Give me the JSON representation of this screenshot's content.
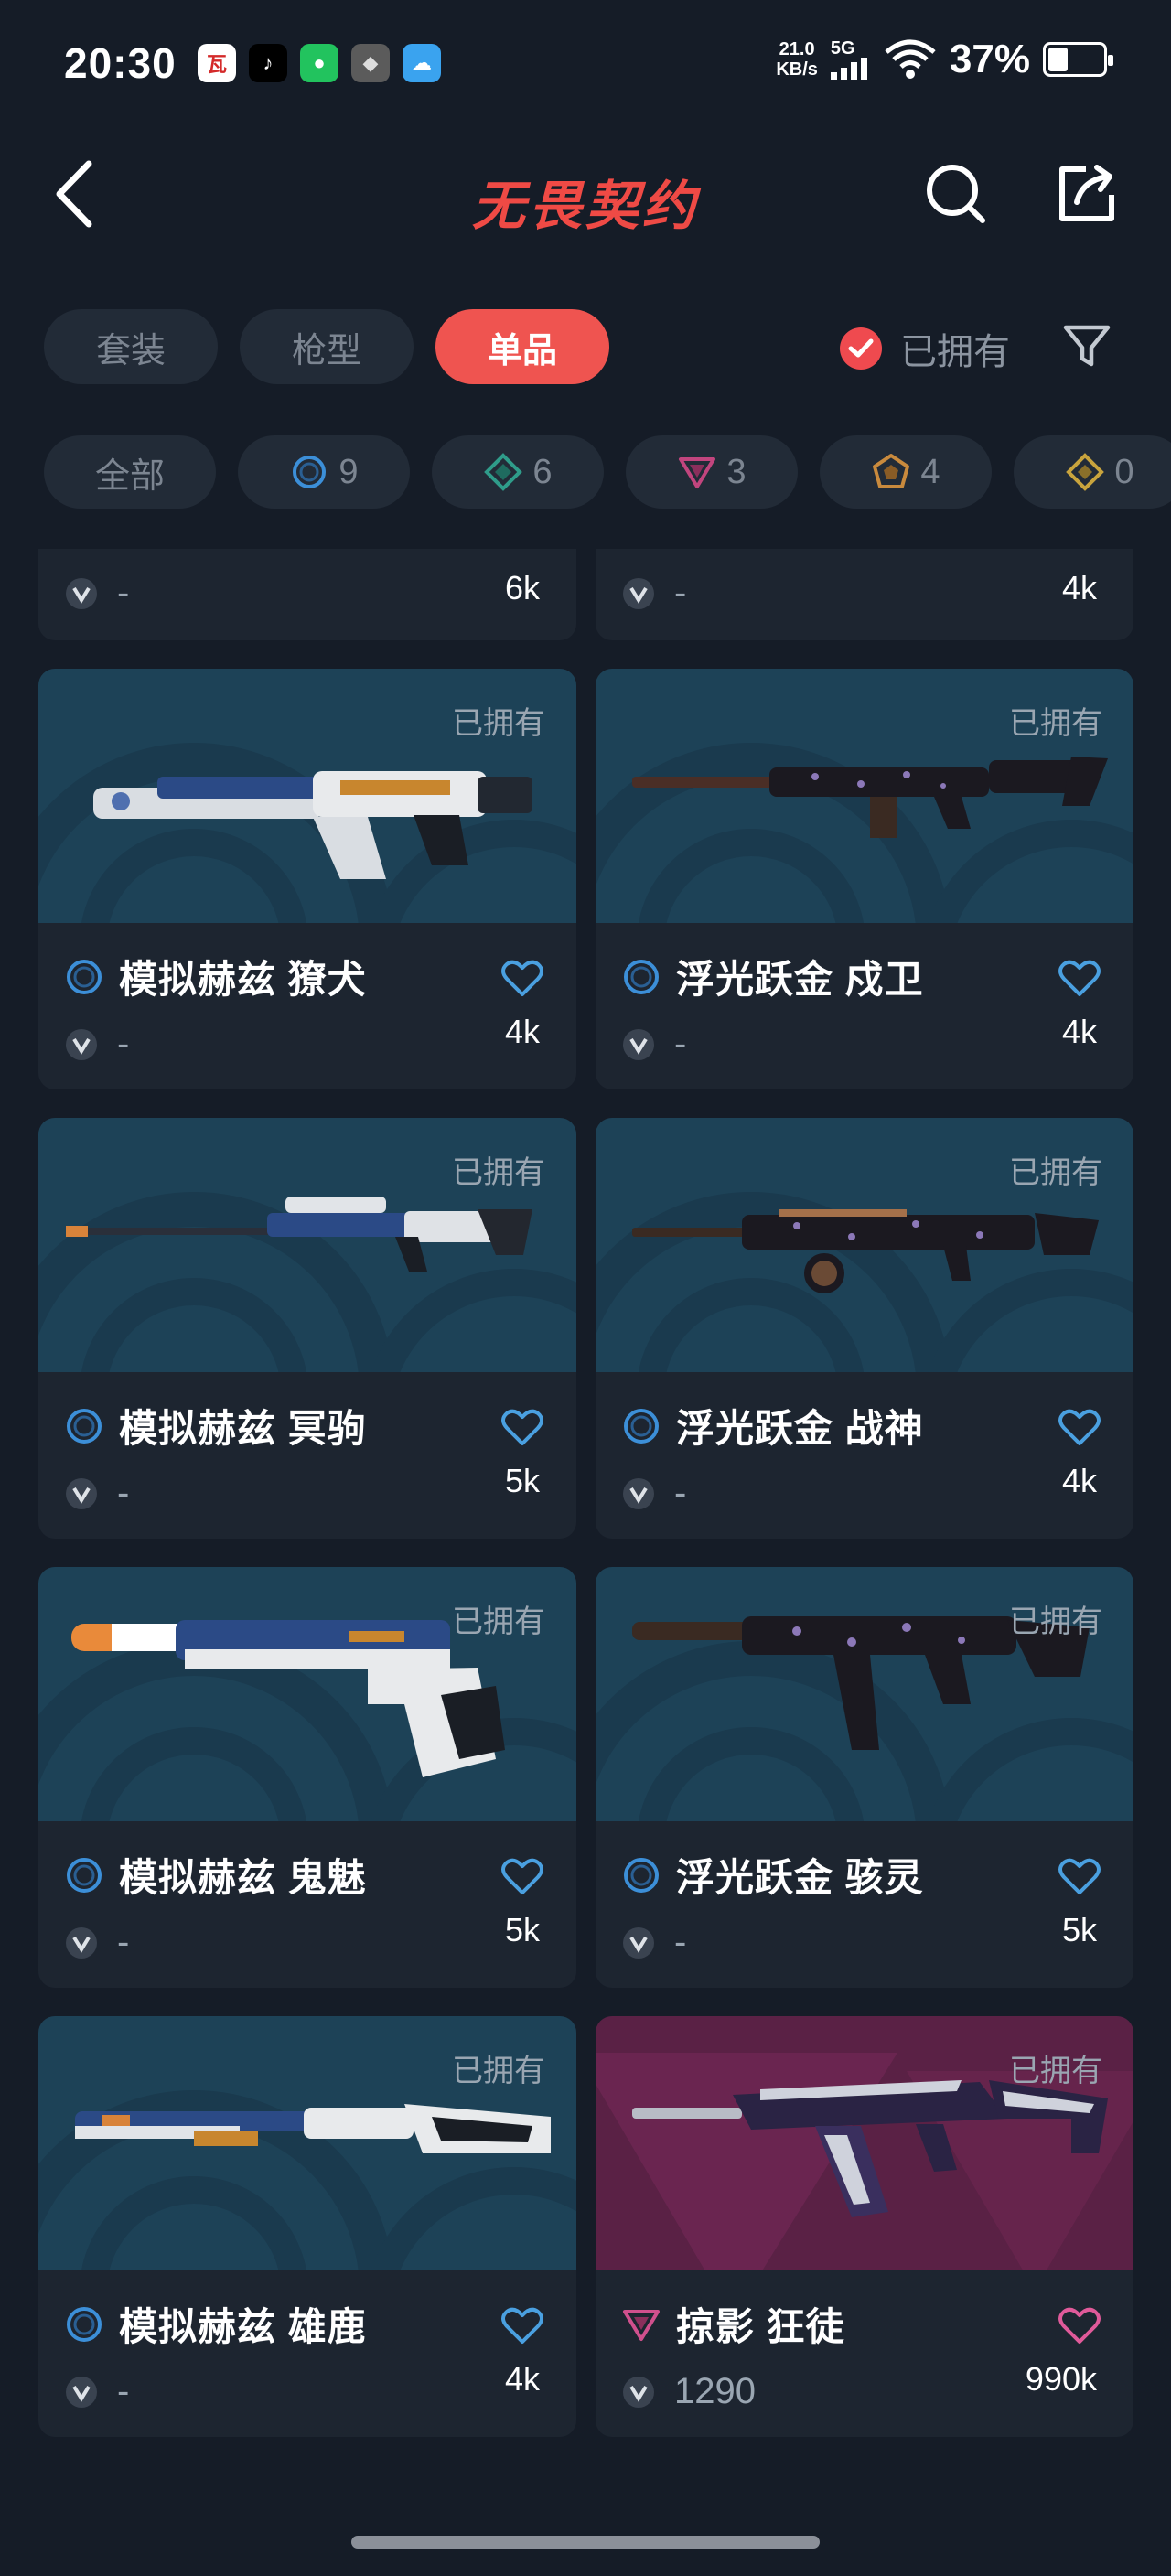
{
  "status_bar": {
    "time": "20:30",
    "net_speed_value": "21.0",
    "net_speed_unit": "KB/s",
    "network": "5G",
    "battery": "37%",
    "battery_level": 0.37,
    "app_icons": [
      "app-icon-red",
      "tiktok-icon",
      "wechat-icon",
      "game-avatar-icon",
      "weather-icon"
    ]
  },
  "header": {
    "title": "无畏契约",
    "title_color": "#ef4a45"
  },
  "tabs": [
    {
      "label": "套装",
      "active": false
    },
    {
      "label": "枪型",
      "active": false
    },
    {
      "label": "单品",
      "active": true
    }
  ],
  "owned_filter": {
    "label": "已拥有",
    "checked": true
  },
  "rarity_filters": [
    {
      "label": "全部",
      "count": ""
    },
    {
      "icon": "select-tier-icon",
      "count": "9",
      "color": "#3c8fd8"
    },
    {
      "icon": "deluxe-tier-icon",
      "count": "6",
      "color": "#2f9c8a"
    },
    {
      "icon": "premium-tier-icon",
      "count": "3",
      "color": "#c2457e"
    },
    {
      "icon": "exclusive-tier-icon",
      "count": "4",
      "color": "#c98a3d"
    },
    {
      "icon": "ultra-tier-icon",
      "count": "0",
      "color": "#c9a43d"
    }
  ],
  "partial_cards": [
    {
      "vp": "-",
      "price": "6k"
    },
    {
      "vp": "-",
      "price": "4k"
    }
  ],
  "cards": [
    {
      "name": "模拟赫兹 獠犬",
      "owned": "已拥有",
      "vp": "-",
      "price": "4k",
      "tier": "select",
      "theme": "blue",
      "weapon": "bulldog"
    },
    {
      "name": "浮光跃金 戍卫",
      "owned": "已拥有",
      "vp": "-",
      "price": "4k",
      "tier": "select",
      "theme": "blue",
      "weapon": "guardian"
    },
    {
      "name": "模拟赫兹 冥驹",
      "owned": "已拥有",
      "vp": "-",
      "price": "5k",
      "tier": "select",
      "theme": "blue",
      "weapon": "marshal"
    },
    {
      "name": "浮光跃金 战神",
      "owned": "已拥有",
      "vp": "-",
      "price": "4k",
      "tier": "select",
      "theme": "blue",
      "weapon": "ares"
    },
    {
      "name": "模拟赫兹 鬼魅",
      "owned": "已拥有",
      "vp": "-",
      "price": "5k",
      "tier": "select",
      "theme": "blue",
      "weapon": "ghost"
    },
    {
      "name": "浮光跃金 骇灵",
      "owned": "已拥有",
      "vp": "-",
      "price": "5k",
      "tier": "select",
      "theme": "blue",
      "weapon": "spectre"
    },
    {
      "name": "模拟赫兹 雄鹿",
      "owned": "已拥有",
      "vp": "-",
      "price": "4k",
      "tier": "select",
      "theme": "blue",
      "weapon": "bucky"
    },
    {
      "name": "掠影 狂徒",
      "owned": "已拥有",
      "vp": "1290",
      "price": "990k",
      "tier": "premium",
      "theme": "purple",
      "weapon": "vandal"
    }
  ],
  "colors": {
    "background": "#151c27",
    "card": "#1d2530",
    "card_image_blue": "#1d4257",
    "card_image_purple": "#5a2145",
    "accent_red": "#ef5450",
    "heart_blue": "#4aa0e0",
    "heart_pink": "#e05a9a"
  }
}
